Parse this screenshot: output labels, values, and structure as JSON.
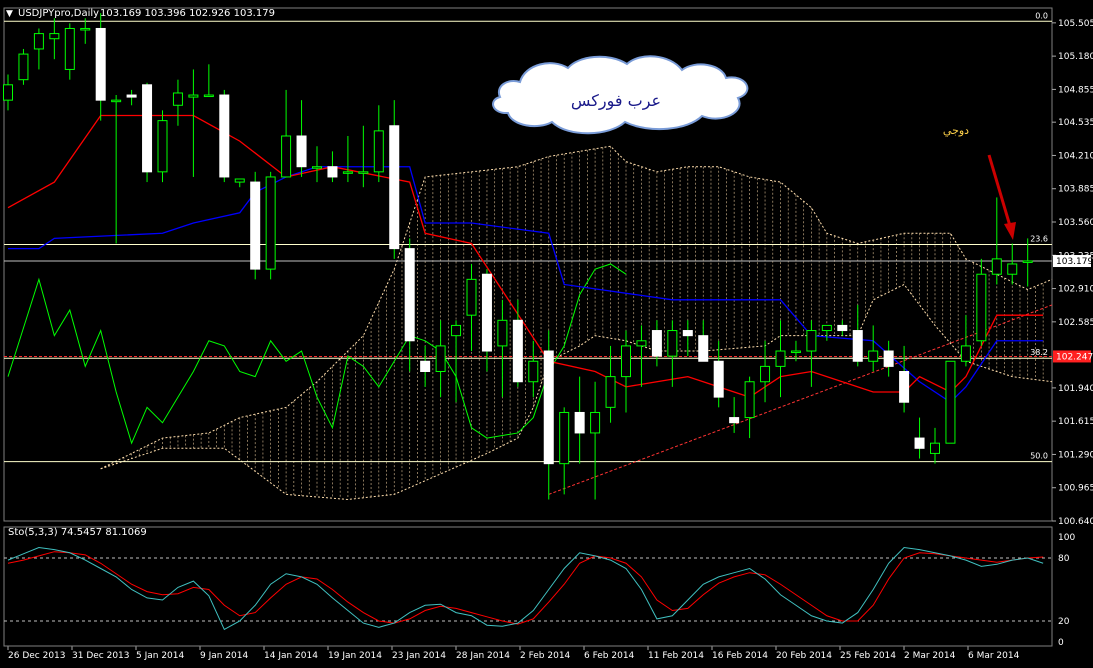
{
  "window": {
    "title": "USDJPYpro,Daily",
    "ohlc": "103.169 103.396 102.926 103.179",
    "stoch_label": "Sto(5,3,3) 74.5457 81.1069"
  },
  "annotations": {
    "cloud_text": "عرب فوركس",
    "doji_text": "دوجي"
  },
  "colors": {
    "background": "#000000",
    "bull_candle": "#ffffff",
    "wick": "#00ff00",
    "tenkan": "#ff0000",
    "kijun": "#0000ff",
    "chikou": "#00ff00",
    "kumo_a": "#ffdead",
    "kumo_b": "#ffdead",
    "fib": "#ffffcc",
    "trendline": "#ff3333",
    "arrow": "#cc0000",
    "stoch_main": "#40c0c0",
    "stoch_signal": "#ff0000"
  },
  "chart_data": {
    "type": "candlestick",
    "symbol": "USDJPYpro",
    "timeframe": "Daily",
    "ylim": [
      100.64,
      105.65
    ],
    "y_ticks": [
      105.505,
      105.18,
      104.855,
      104.535,
      104.21,
      103.885,
      103.56,
      103.235,
      102.91,
      102.585,
      101.94,
      101.615,
      101.29,
      100.965,
      100.64
    ],
    "x_labels": [
      "26 Dec 2013",
      "31 Dec 2013",
      "5 Jan 2014",
      "9 Jan 2014",
      "14 Jan 2014",
      "19 Jan 2014",
      "23 Jan 2014",
      "28 Jan 2014",
      "2 Feb 2014",
      "6 Feb 2014",
      "11 Feb 2014",
      "16 Feb 2014",
      "20 Feb 2014",
      "25 Feb 2014",
      "2 Mar 2014",
      "6 Mar 2014"
    ],
    "price_label": "103.179",
    "support_label": "102.247",
    "fib_levels": [
      {
        "label": "0.0",
        "value": 105.52
      },
      {
        "label": "23.6",
        "value": 103.34
      },
      {
        "label": "38.2",
        "value": 102.23
      },
      {
        "label": "50.0",
        "value": 101.22
      }
    ],
    "candles": [
      {
        "o": 104.75,
        "h": 105.0,
        "l": 104.65,
        "c": 104.9
      },
      {
        "o": 104.95,
        "h": 105.25,
        "l": 104.9,
        "c": 105.2
      },
      {
        "o": 105.25,
        "h": 105.45,
        "l": 105.05,
        "c": 105.4
      },
      {
        "o": 105.35,
        "h": 105.55,
        "l": 105.15,
        "c": 105.4
      },
      {
        "o": 105.05,
        "h": 105.5,
        "l": 104.95,
        "c": 105.45
      },
      {
        "o": 105.45,
        "h": 105.55,
        "l": 105.3,
        "c": 105.45
      },
      {
        "o": 105.45,
        "h": 105.6,
        "l": 104.55,
        "c": 104.75
      },
      {
        "o": 104.75,
        "h": 104.8,
        "l": 103.35,
        "c": 104.75
      },
      {
        "o": 104.8,
        "h": 104.85,
        "l": 104.7,
        "c": 104.78
      },
      {
        "o": 104.9,
        "h": 104.92,
        "l": 103.95,
        "c": 104.05
      },
      {
        "o": 104.05,
        "h": 104.65,
        "l": 103.95,
        "c": 104.55
      },
      {
        "o": 104.7,
        "h": 104.95,
        "l": 104.5,
        "c": 104.82
      },
      {
        "o": 104.78,
        "h": 105.05,
        "l": 104.0,
        "c": 104.8
      },
      {
        "o": 104.8,
        "h": 105.1,
        "l": 104.8,
        "c": 104.8
      },
      {
        "o": 104.8,
        "h": 104.85,
        "l": 103.95,
        "c": 104.0
      },
      {
        "o": 103.95,
        "h": 103.98,
        "l": 103.9,
        "c": 103.98
      },
      {
        "o": 103.95,
        "h": 104.05,
        "l": 103.0,
        "c": 103.1
      },
      {
        "o": 103.1,
        "h": 104.05,
        "l": 103.0,
        "c": 104.0
      },
      {
        "o": 104.0,
        "h": 104.85,
        "l": 104.0,
        "c": 104.4
      },
      {
        "o": 104.4,
        "h": 104.75,
        "l": 104.0,
        "c": 104.1
      },
      {
        "o": 104.1,
        "h": 104.3,
        "l": 103.95,
        "c": 104.1
      },
      {
        "o": 104.1,
        "h": 104.25,
        "l": 103.95,
        "c": 104.0
      },
      {
        "o": 104.05,
        "h": 104.4,
        "l": 103.95,
        "c": 104.05
      },
      {
        "o": 104.05,
        "h": 104.5,
        "l": 103.9,
        "c": 104.05
      },
      {
        "o": 104.05,
        "h": 104.7,
        "l": 103.95,
        "c": 104.45
      },
      {
        "o": 104.5,
        "h": 104.75,
        "l": 103.2,
        "c": 103.3
      },
      {
        "o": 103.3,
        "h": 103.4,
        "l": 102.1,
        "c": 102.4
      },
      {
        "o": 102.2,
        "h": 102.35,
        "l": 101.95,
        "c": 102.1
      },
      {
        "o": 102.1,
        "h": 102.6,
        "l": 101.85,
        "c": 102.35
      },
      {
        "o": 102.45,
        "h": 102.6,
        "l": 101.8,
        "c": 102.55
      },
      {
        "o": 102.65,
        "h": 103.15,
        "l": 102.3,
        "c": 103.0
      },
      {
        "o": 103.05,
        "h": 103.1,
        "l": 102.1,
        "c": 102.3
      },
      {
        "o": 102.35,
        "h": 102.8,
        "l": 101.85,
        "c": 102.6
      },
      {
        "o": 102.6,
        "h": 102.8,
        "l": 101.95,
        "c": 102.0
      },
      {
        "o": 102.0,
        "h": 102.4,
        "l": 101.85,
        "c": 102.2
      },
      {
        "o": 102.3,
        "h": 102.5,
        "l": 100.85,
        "c": 101.2
      },
      {
        "o": 101.2,
        "h": 101.75,
        "l": 100.9,
        "c": 101.7
      },
      {
        "o": 101.7,
        "h": 102.05,
        "l": 101.2,
        "c": 101.5
      },
      {
        "o": 101.5,
        "h": 102.0,
        "l": 100.85,
        "c": 101.7
      },
      {
        "o": 101.75,
        "h": 102.35,
        "l": 101.6,
        "c": 102.05
      },
      {
        "o": 102.05,
        "h": 102.5,
        "l": 101.7,
        "c": 102.35
      },
      {
        "o": 102.35,
        "h": 102.55,
        "l": 101.95,
        "c": 102.4
      },
      {
        "o": 102.5,
        "h": 102.6,
        "l": 102.15,
        "c": 102.25
      },
      {
        "o": 102.25,
        "h": 102.6,
        "l": 101.95,
        "c": 102.5
      },
      {
        "o": 102.5,
        "h": 102.6,
        "l": 102.25,
        "c": 102.45
      },
      {
        "o": 102.45,
        "h": 102.6,
        "l": 102.3,
        "c": 102.2
      },
      {
        "o": 102.2,
        "h": 102.4,
        "l": 101.75,
        "c": 101.85
      },
      {
        "o": 101.65,
        "h": 101.85,
        "l": 101.5,
        "c": 101.6
      },
      {
        "o": 101.65,
        "h": 102.05,
        "l": 101.45,
        "c": 102.0
      },
      {
        "o": 102.0,
        "h": 102.4,
        "l": 101.8,
        "c": 102.15
      },
      {
        "o": 102.15,
        "h": 102.6,
        "l": 101.85,
        "c": 102.3
      },
      {
        "o": 102.3,
        "h": 102.4,
        "l": 102.2,
        "c": 102.3
      },
      {
        "o": 102.3,
        "h": 102.6,
        "l": 101.95,
        "c": 102.5
      },
      {
        "o": 102.5,
        "h": 102.55,
        "l": 102.4,
        "c": 102.55
      },
      {
        "o": 102.55,
        "h": 102.6,
        "l": 102.45,
        "c": 102.5
      },
      {
        "o": 102.5,
        "h": 102.75,
        "l": 102.15,
        "c": 102.2
      },
      {
        "o": 102.2,
        "h": 102.55,
        "l": 102.1,
        "c": 102.3
      },
      {
        "o": 102.3,
        "h": 102.4,
        "l": 102.05,
        "c": 102.15
      },
      {
        "o": 102.1,
        "h": 102.35,
        "l": 101.7,
        "c": 101.8
      },
      {
        "o": 101.45,
        "h": 101.65,
        "l": 101.25,
        "c": 101.35
      },
      {
        "o": 101.3,
        "h": 101.55,
        "l": 101.2,
        "c": 101.4
      },
      {
        "o": 101.4,
        "h": 102.2,
        "l": 101.4,
        "c": 102.2
      },
      {
        "o": 102.2,
        "h": 102.65,
        "l": 102.15,
        "c": 102.35
      },
      {
        "o": 102.4,
        "h": 103.2,
        "l": 102.35,
        "c": 103.05
      },
      {
        "o": 103.05,
        "h": 103.8,
        "l": 102.95,
        "c": 103.2
      },
      {
        "o": 103.05,
        "h": 103.35,
        "l": 102.95,
        "c": 103.15
      },
      {
        "o": 103.17,
        "h": 103.4,
        "l": 102.93,
        "c": 103.18
      }
    ],
    "tenkan": [
      [
        0,
        103.7
      ],
      [
        3,
        103.95
      ],
      [
        6,
        104.6
      ],
      [
        12,
        104.6
      ],
      [
        15,
        104.35
      ],
      [
        18,
        104.0
      ],
      [
        21,
        104.1
      ],
      [
        26,
        103.95
      ],
      [
        27,
        103.45
      ],
      [
        30,
        103.35
      ],
      [
        35,
        102.2
      ],
      [
        38,
        102.1
      ],
      [
        40,
        101.95
      ],
      [
        44,
        102.05
      ],
      [
        48,
        101.85
      ],
      [
        50,
        102.05
      ],
      [
        52,
        102.1
      ],
      [
        56,
        101.9
      ],
      [
        58,
        101.9
      ],
      [
        59,
        102.05
      ],
      [
        61,
        101.9
      ],
      [
        62,
        102.05
      ],
      [
        64,
        102.65
      ],
      [
        67,
        102.65
      ]
    ],
    "kijun": [
      [
        0,
        103.3
      ],
      [
        2,
        103.3
      ],
      [
        3,
        103.4
      ],
      [
        10,
        103.45
      ],
      [
        12,
        103.55
      ],
      [
        15,
        103.65
      ],
      [
        16,
        103.85
      ],
      [
        18,
        104.0
      ],
      [
        20,
        104.1
      ],
      [
        26,
        104.1
      ],
      [
        27,
        103.55
      ],
      [
        30,
        103.55
      ],
      [
        35,
        103.45
      ],
      [
        36,
        102.95
      ],
      [
        43,
        102.8
      ],
      [
        50,
        102.8
      ],
      [
        52,
        102.45
      ],
      [
        56,
        102.4
      ],
      [
        59,
        102.0
      ],
      [
        61,
        101.8
      ],
      [
        62,
        101.95
      ],
      [
        64,
        102.4
      ],
      [
        67,
        102.4
      ]
    ],
    "chikou": [
      [
        0,
        102.05
      ],
      [
        2,
        103.0
      ],
      [
        3,
        102.45
      ],
      [
        4,
        102.7
      ],
      [
        5,
        102.15
      ],
      [
        6,
        102.5
      ],
      [
        7,
        101.9
      ],
      [
        8,
        101.4
      ],
      [
        9,
        101.75
      ],
      [
        10,
        101.6
      ],
      [
        12,
        102.1
      ],
      [
        13,
        102.4
      ],
      [
        14,
        102.35
      ],
      [
        15,
        102.1
      ],
      [
        16,
        102.05
      ],
      [
        17,
        102.4
      ],
      [
        18,
        102.2
      ],
      [
        19,
        102.3
      ],
      [
        20,
        101.85
      ],
      [
        21,
        101.55
      ],
      [
        22,
        102.25
      ],
      [
        23,
        102.15
      ],
      [
        24,
        101.95
      ],
      [
        25,
        102.2
      ],
      [
        26,
        102.45
      ],
      [
        27,
        102.4
      ],
      [
        28,
        102.3
      ],
      [
        29,
        102.05
      ],
      [
        30,
        101.55
      ],
      [
        31,
        101.45
      ],
      [
        33,
        101.5
      ],
      [
        34,
        101.65
      ],
      [
        35,
        102.1
      ],
      [
        36,
        102.35
      ],
      [
        37,
        102.85
      ],
      [
        38,
        103.1
      ],
      [
        39,
        103.15
      ],
      [
        40,
        103.05
      ]
    ],
    "senkou_a": [
      [
        6,
        101.15
      ],
      [
        10,
        101.45
      ],
      [
        13,
        101.5
      ],
      [
        15,
        101.65
      ],
      [
        18,
        101.75
      ],
      [
        20,
        102.0
      ],
      [
        23,
        102.15
      ],
      [
        25,
        102.2
      ],
      [
        27,
        102.65
      ],
      [
        30,
        102.85
      ],
      [
        33,
        103.3
      ],
      [
        35,
        103.15
      ],
      [
        38,
        103.45
      ],
      [
        41,
        103.65
      ],
      [
        44,
        103.8
      ],
      [
        46,
        103.8
      ],
      [
        48,
        103.8
      ],
      [
        49,
        103.65
      ],
      [
        50,
        103.55
      ],
      [
        51,
        103.45
      ],
      [
        52,
        103.55
      ],
      [
        53,
        103.15
      ],
      [
        55,
        103.05
      ],
      [
        58,
        103.45
      ],
      [
        61,
        103.55
      ],
      [
        62,
        103.35
      ],
      [
        63,
        103.2
      ],
      [
        64,
        103.05
      ],
      [
        66,
        102.9
      ],
      [
        68,
        103.0
      ]
    ],
    "senkou_b": [
      [
        6,
        101.15
      ],
      [
        10,
        101.35
      ],
      [
        14,
        101.35
      ],
      [
        18,
        100.9
      ],
      [
        22,
        100.85
      ],
      [
        25,
        100.9
      ],
      [
        28,
        101.1
      ],
      [
        31,
        101.3
      ],
      [
        33,
        101.45
      ],
      [
        34,
        101.75
      ],
      [
        35,
        102.2
      ],
      [
        37,
        102.35
      ],
      [
        38,
        102.45
      ],
      [
        40,
        102.4
      ],
      [
        42,
        102.3
      ],
      [
        45,
        102.3
      ],
      [
        49,
        102.35
      ],
      [
        50,
        102.45
      ],
      [
        55,
        102.45
      ],
      [
        56,
        102.8
      ],
      [
        58,
        102.95
      ],
      [
        60,
        102.55
      ],
      [
        62,
        102.2
      ],
      [
        65,
        102.05
      ],
      [
        68,
        102.0
      ]
    ],
    "kumo_top": [
      [
        6,
        101.15
      ],
      [
        10,
        101.45
      ],
      [
        13,
        101.5
      ],
      [
        15,
        101.65
      ],
      [
        18,
        101.75
      ],
      [
        20,
        102.0
      ],
      [
        23,
        102.45
      ],
      [
        25,
        103.1
      ],
      [
        27,
        104.0
      ],
      [
        30,
        104.05
      ],
      [
        33,
        104.1
      ],
      [
        35,
        104.2
      ],
      [
        37,
        104.25
      ],
      [
        39,
        104.3
      ],
      [
        40,
        104.15
      ],
      [
        42,
        104.05
      ],
      [
        44,
        104.1
      ],
      [
        46,
        104.1
      ],
      [
        48,
        104.0
      ],
      [
        50,
        103.95
      ],
      [
        52,
        103.7
      ],
      [
        53,
        103.45
      ],
      [
        55,
        103.35
      ],
      [
        58,
        103.45
      ],
      [
        61,
        103.45
      ],
      [
        62,
        103.2
      ],
      [
        64,
        103.05
      ],
      [
        66,
        102.9
      ],
      [
        68,
        103.0
      ]
    ],
    "trendline": {
      "from": [
        35,
        100.9
      ],
      "to": [
        68,
        102.75
      ]
    },
    "stochastic": {
      "ylim": [
        0,
        100
      ],
      "levels": [
        80,
        20
      ],
      "tick_labels": [
        "100",
        "80",
        "20",
        "0"
      ],
      "main": [
        78,
        84,
        90,
        88,
        85,
        78,
        70,
        62,
        50,
        42,
        40,
        52,
        58,
        44,
        12,
        20,
        35,
        55,
        65,
        62,
        55,
        42,
        30,
        18,
        14,
        18,
        28,
        35,
        36,
        28,
        25,
        16,
        15,
        18,
        30,
        50,
        70,
        85,
        82,
        78,
        70,
        50,
        22,
        25,
        40,
        55,
        62,
        66,
        70,
        60,
        45,
        35,
        25,
        20,
        18,
        28,
        50,
        75,
        90,
        88,
        85,
        82,
        78,
        72,
        74,
        78,
        80,
        75
      ],
      "signal": [
        75,
        78,
        82,
        86,
        85,
        83,
        75,
        65,
        55,
        48,
        45,
        46,
        52,
        50,
        35,
        25,
        28,
        42,
        55,
        62,
        60,
        50,
        38,
        28,
        20,
        18,
        22,
        30,
        34,
        32,
        28,
        24,
        20,
        17,
        22,
        38,
        55,
        75,
        82,
        80,
        75,
        62,
        40,
        30,
        32,
        45,
        56,
        62,
        66,
        64,
        55,
        45,
        35,
        25,
        20,
        20,
        35,
        60,
        80,
        85,
        84,
        82,
        80,
        78,
        76,
        78,
        80,
        81
      ]
    }
  }
}
